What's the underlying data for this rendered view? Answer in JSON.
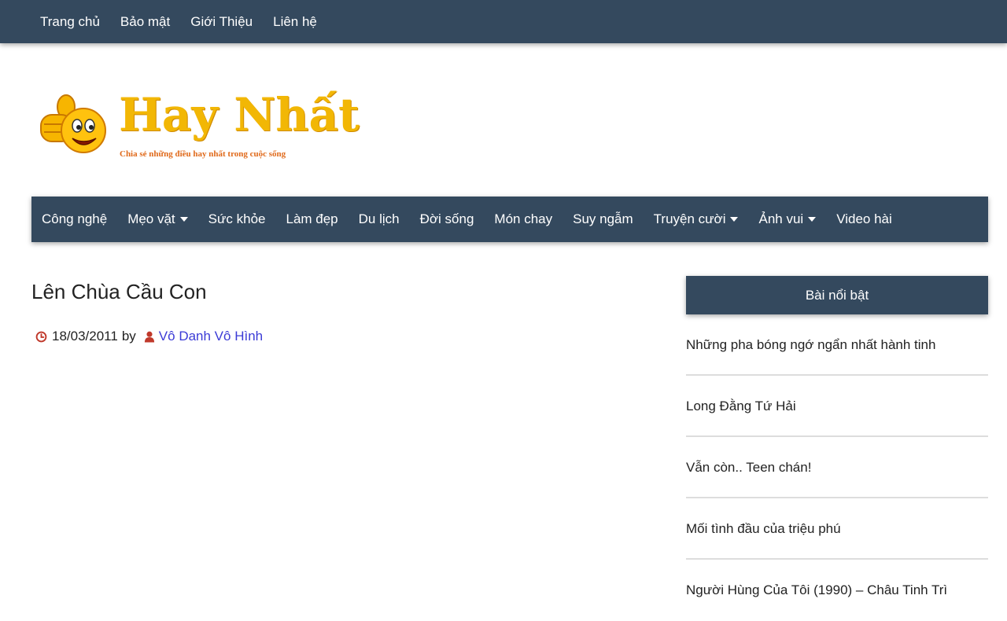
{
  "top_nav": {
    "items": [
      "Trang chủ",
      "Bảo mật",
      "Giới Thiệu",
      "Liên hệ"
    ]
  },
  "logo": {
    "title": "Hay Nhất",
    "tagline": "Chia sẻ những điều hay nhất trong cuộc sống"
  },
  "main_nav": {
    "items": [
      {
        "label": "Công nghệ",
        "dropdown": false
      },
      {
        "label": "Mẹo vặt",
        "dropdown": true
      },
      {
        "label": "Sức khỏe",
        "dropdown": false
      },
      {
        "label": "Làm đẹp",
        "dropdown": false
      },
      {
        "label": "Du lịch",
        "dropdown": false
      },
      {
        "label": "Đời sống",
        "dropdown": false
      },
      {
        "label": "Món chay",
        "dropdown": false
      },
      {
        "label": "Suy ngẫm",
        "dropdown": false
      },
      {
        "label": "Truyện cười",
        "dropdown": true
      },
      {
        "label": "Ảnh vui",
        "dropdown": true
      },
      {
        "label": "Video hài",
        "dropdown": false
      }
    ]
  },
  "post": {
    "title": "Lên Chùa Cầu Con",
    "date": "18/03/2011",
    "by": "by",
    "author": "Vô Danh Vô Hình"
  },
  "sidebar": {
    "widget_title": "Bài nổi bật",
    "items": [
      "Những pha bóng ngớ ngẩn nhất hành tinh",
      "Long Đằng Tứ Hải",
      "Vẫn còn.. Teen chán!",
      "Mối tình đầu của triệu phú",
      "Người Hùng Của Tôi (1990) – Châu Tinh Trì"
    ]
  },
  "colors": {
    "nav_bg": "#34495e",
    "logo_yellow": "#f2b705",
    "meta_icon_red": "#c0392b",
    "author_link": "#3b3bd6"
  },
  "icons": {
    "date": "clock-icon",
    "author": "user-icon",
    "logo": "thumbs-up-smiley-icon",
    "dropdown": "caret-down-icon"
  }
}
